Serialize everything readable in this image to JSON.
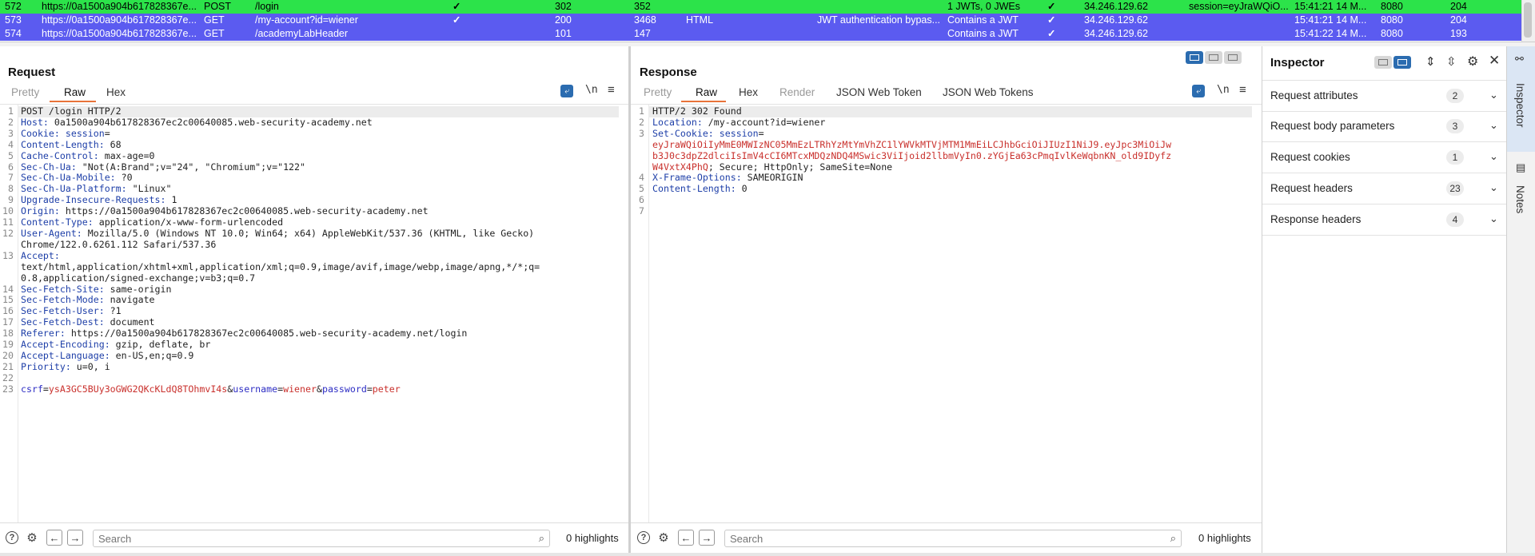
{
  "history": {
    "rows": [
      {
        "num": "572",
        "host": "https://0a1500a904b617828367e...",
        "method": "POST",
        "url": "/login",
        "params": "✓",
        "status": "302",
        "length": "352",
        "mime": "",
        "title": "",
        "notes": "1 JWTs, 0 JWEs",
        "tls": "✓",
        "ip": "34.246.129.62",
        "cookies": "session=eyJraWQiO...",
        "time": "15:41:21 14 M...",
        "port": "8080",
        "extra": "204",
        "style": "green"
      },
      {
        "num": "573",
        "host": "https://0a1500a904b617828367e...",
        "method": "GET",
        "url": "/my-account?id=wiener",
        "params": "✓",
        "status": "200",
        "length": "3468",
        "mime": "HTML",
        "title": "JWT authentication bypas...",
        "notes": "Contains a JWT",
        "tls": "✓",
        "ip": "34.246.129.62",
        "cookies": "",
        "time": "15:41:21 14 M...",
        "port": "8080",
        "extra": "204",
        "style": "blue"
      },
      {
        "num": "574",
        "host": "https://0a1500a904b617828367e...",
        "method": "GET",
        "url": "/academyLabHeader",
        "params": "",
        "status": "101",
        "length": "147",
        "mime": "",
        "title": "",
        "notes": "Contains a JWT",
        "tls": "✓",
        "ip": "34.246.129.62",
        "cookies": "",
        "time": "15:41:22 14 M...",
        "port": "8080",
        "extra": "193",
        "style": "blue"
      }
    ]
  },
  "request": {
    "title": "Request",
    "tabs": [
      "Pretty",
      "Raw",
      "Hex"
    ],
    "active_tab": "Raw",
    "newline_toggle": "\\n",
    "search_placeholder": "Search",
    "highlights": "0 highlights"
  },
  "response": {
    "title": "Response",
    "tabs": [
      "Pretty",
      "Raw",
      "Hex",
      "Render",
      "JSON Web Token",
      "JSON Web Tokens"
    ],
    "active_tab": "Raw",
    "newline_toggle": "\\n",
    "search_placeholder": "Search",
    "highlights": "0 highlights"
  },
  "request_lines": [
    {
      "n": "1",
      "lines": [
        [
          [
            "",
            "POST /login HTTP/2"
          ]
        ]
      ]
    },
    {
      "n": "2",
      "lines": [
        [
          [
            "hk",
            "Host:"
          ],
          [
            "hv",
            " 0a1500a904b617828367ec2c00640085.web-security-academy.net"
          ]
        ]
      ]
    },
    {
      "n": "3",
      "lines": [
        [
          [
            "hk",
            "Cookie:"
          ],
          [
            "hv",
            " "
          ],
          [
            "hk",
            "session"
          ],
          [
            "hv",
            "="
          ]
        ]
      ]
    },
    {
      "n": "4",
      "lines": [
        [
          [
            "hk",
            "Content-Length:"
          ],
          [
            "hv",
            " 68"
          ]
        ]
      ]
    },
    {
      "n": "5",
      "lines": [
        [
          [
            "hk",
            "Cache-Control:"
          ],
          [
            "hv",
            " max-age=0"
          ]
        ]
      ]
    },
    {
      "n": "6",
      "lines": [
        [
          [
            "hk",
            "Sec-Ch-Ua:"
          ],
          [
            "hv",
            " \"Not(A:Brand\";v=\"24\", \"Chromium\";v=\"122\""
          ]
        ]
      ]
    },
    {
      "n": "7",
      "lines": [
        [
          [
            "hk",
            "Sec-Ch-Ua-Mobile:"
          ],
          [
            "hv",
            " ?0"
          ]
        ]
      ]
    },
    {
      "n": "8",
      "lines": [
        [
          [
            "hk",
            "Sec-Ch-Ua-Platform:"
          ],
          [
            "hv",
            " \"Linux\""
          ]
        ]
      ]
    },
    {
      "n": "9",
      "lines": [
        [
          [
            "hk",
            "Upgrade-Insecure-Requests:"
          ],
          [
            "hv",
            " 1"
          ]
        ]
      ]
    },
    {
      "n": "10",
      "lines": [
        [
          [
            "hk",
            "Origin:"
          ],
          [
            "hv",
            " https://0a1500a904b617828367ec2c00640085.web-security-academy.net"
          ]
        ]
      ]
    },
    {
      "n": "11",
      "lines": [
        [
          [
            "hk",
            "Content-Type:"
          ],
          [
            "hv",
            " application/x-www-form-urlencoded"
          ]
        ]
      ]
    },
    {
      "n": "12",
      "lines": [
        [
          [
            "hk",
            "User-Agent:"
          ],
          [
            "hv",
            " Mozilla/5.0 (Windows NT 10.0; Win64; x64) AppleWebKit/537.36 (KHTML, like Gecko)"
          ]
        ],
        [
          [
            "hv",
            "Chrome/122.0.6261.112 Safari/537.36"
          ]
        ]
      ]
    },
    {
      "n": "13",
      "lines": [
        [
          [
            "hk",
            "Accept:"
          ]
        ],
        [
          [
            "hv",
            "text/html,application/xhtml+xml,application/xml;q=0.9,image/avif,image/webp,image/apng,*/*;q="
          ]
        ],
        [
          [
            "hv",
            "0.8,application/signed-exchange;v=b3;q=0.7"
          ]
        ]
      ]
    },
    {
      "n": "14",
      "lines": [
        [
          [
            "hk",
            "Sec-Fetch-Site:"
          ],
          [
            "hv",
            " same-origin"
          ]
        ]
      ]
    },
    {
      "n": "15",
      "lines": [
        [
          [
            "hk",
            "Sec-Fetch-Mode:"
          ],
          [
            "hv",
            " navigate"
          ]
        ]
      ]
    },
    {
      "n": "16",
      "lines": [
        [
          [
            "hk",
            "Sec-Fetch-User:"
          ],
          [
            "hv",
            " ?1"
          ]
        ]
      ]
    },
    {
      "n": "17",
      "lines": [
        [
          [
            "hk",
            "Sec-Fetch-Dest:"
          ],
          [
            "hv",
            " document"
          ]
        ]
      ]
    },
    {
      "n": "18",
      "lines": [
        [
          [
            "hk",
            "Referer:"
          ],
          [
            "hv",
            " https://0a1500a904b617828367ec2c00640085.web-security-academy.net/login"
          ]
        ]
      ]
    },
    {
      "n": "19",
      "lines": [
        [
          [
            "hk",
            "Accept-Encoding:"
          ],
          [
            "hv",
            " gzip, deflate, br"
          ]
        ]
      ]
    },
    {
      "n": "20",
      "lines": [
        [
          [
            "hk",
            "Accept-Language:"
          ],
          [
            "hv",
            " en-US,en;q=0.9"
          ]
        ]
      ]
    },
    {
      "n": "21",
      "lines": [
        [
          [
            "hk",
            "Priority:"
          ],
          [
            "hv",
            " u=0, i"
          ]
        ]
      ]
    },
    {
      "n": "22",
      "lines": [
        [
          [
            "hv",
            ""
          ]
        ]
      ]
    },
    {
      "n": "23",
      "lines": [
        [
          [
            "pk",
            "csrf"
          ],
          [
            "hv",
            "="
          ],
          [
            "pv",
            "ysA3GC5BUy3oGWG2QKcKLdQ8TOhmvI4s"
          ],
          [
            "hv",
            "&"
          ],
          [
            "pk",
            "username"
          ],
          [
            "hv",
            "="
          ],
          [
            "pv",
            "wiener"
          ],
          [
            "hv",
            "&"
          ],
          [
            "pk",
            "password"
          ],
          [
            "hv",
            "="
          ],
          [
            "pv",
            "peter"
          ]
        ]
      ]
    }
  ],
  "response_lines": [
    {
      "n": "1",
      "lines": [
        [
          [
            "",
            "HTTP/2 302 Found"
          ]
        ]
      ]
    },
    {
      "n": "2",
      "lines": [
        [
          [
            "hk",
            "Location:"
          ],
          [
            "hv",
            " /my-account?id=wiener"
          ]
        ]
      ]
    },
    {
      "n": "3",
      "lines": [
        [
          [
            "hk",
            "Set-Cookie:"
          ],
          [
            "hv",
            " "
          ],
          [
            "hk",
            "session"
          ],
          [
            "hv",
            "="
          ]
        ],
        [
          [
            "red",
            "eyJraWQiOiIyMmE0MWIzNC05MmEzLTRhYzMtYmVhZC1lYWVkMTVjMTM1MmEiLCJhbGciOiJIUzI1NiJ9.eyJpc3MiOiJw"
          ]
        ],
        [
          [
            "red",
            "b3J0c3dpZ2dlciIsImV4cCI6MTcxMDQzNDQ4MSwic3ViIjoid2llbmVyIn0.zYGjEa63cPmqIvlKeWqbnKN_old9IDyfz"
          ]
        ],
        [
          [
            "red",
            "W4VxtX4PhQ"
          ],
          [
            "hv",
            "; Secure; HttpOnly; SameSite=None"
          ]
        ]
      ]
    },
    {
      "n": "4",
      "lines": [
        [
          [
            "hk",
            "X-Frame-Options:"
          ],
          [
            "hv",
            " SAMEORIGIN"
          ]
        ]
      ]
    },
    {
      "n": "5",
      "lines": [
        [
          [
            "hk",
            "Content-Length:"
          ],
          [
            "hv",
            " 0"
          ]
        ]
      ]
    },
    {
      "n": "6",
      "lines": [
        [
          [
            "hv",
            ""
          ]
        ]
      ]
    },
    {
      "n": "7",
      "lines": [
        [
          [
            "hv",
            ""
          ]
        ]
      ]
    }
  ],
  "inspector": {
    "title": "Inspector",
    "sections": [
      {
        "label": "Request attributes",
        "count": "2"
      },
      {
        "label": "Request body parameters",
        "count": "3"
      },
      {
        "label": "Request cookies",
        "count": "1"
      },
      {
        "label": "Request headers",
        "count": "23"
      },
      {
        "label": "Response headers",
        "count": "4"
      }
    ]
  },
  "side_tabs": [
    "Inspector",
    "Notes"
  ],
  "colors": {
    "green_row": "#2ce34a",
    "blue_row": "#5b5bf0",
    "accent": "#e8733a",
    "header_key": "#1e3fa8",
    "param_value": "#c9302c"
  }
}
